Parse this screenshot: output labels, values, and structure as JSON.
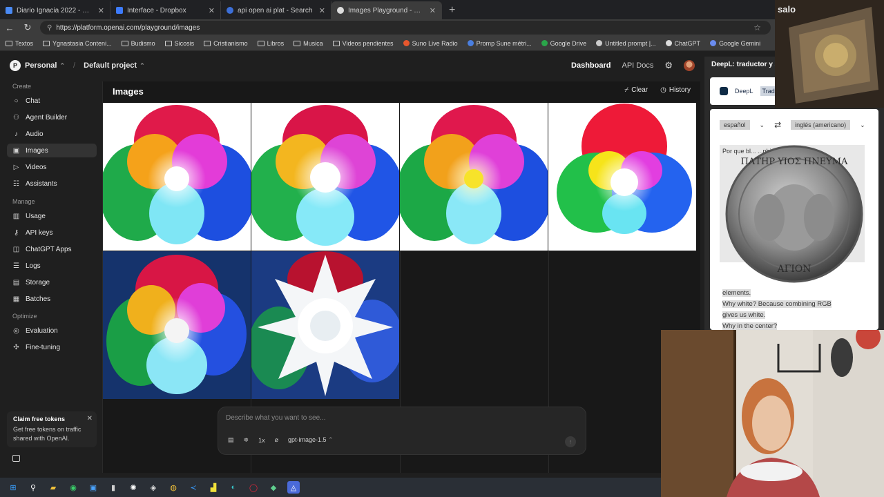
{
  "browser": {
    "tabs": [
      {
        "title": "Diario Ignacia 2022 - Documentos",
        "color": "#4a8af4"
      },
      {
        "title": "Interface - Dropbox",
        "color": "#3d7bfd"
      },
      {
        "title": "api open ai plat - Search",
        "color": "#3c6fd8"
      },
      {
        "title": "Images Playground - OpenAI API",
        "color": "#888888"
      }
    ],
    "url": "https://platform.openai.com/playground/images",
    "bookmarks": [
      {
        "label": "Textos",
        "type": "folder"
      },
      {
        "label": "Ygnastasia Conteni...",
        "type": "folder"
      },
      {
        "label": "Budismo",
        "type": "folder"
      },
      {
        "label": "Sicosis",
        "type": "folder"
      },
      {
        "label": "Cristianismo",
        "type": "folder"
      },
      {
        "label": "Libros",
        "type": "folder"
      },
      {
        "label": "Musica",
        "type": "folder"
      },
      {
        "label": "Videos pendientes",
        "type": "folder"
      },
      {
        "label": "Suno Live Radio",
        "type": "dot",
        "color": "#e8572d"
      },
      {
        "label": "Promp Sune métri...",
        "type": "dot",
        "color": "#4a7fe0"
      },
      {
        "label": "Google Drive",
        "type": "dot",
        "color": "#2aa54a"
      },
      {
        "label": "Untitled prompt |...",
        "type": "dot",
        "color": "#cccccc"
      },
      {
        "label": "ChatGPT",
        "type": "dot",
        "color": "#dcdcdc"
      },
      {
        "label": "Google Gemini",
        "type": "dot",
        "color": "#6a8cf0"
      }
    ]
  },
  "app": {
    "org_initial": "P",
    "org": "Personal",
    "project": "Default project",
    "dashboard": "Dashboard",
    "api_docs": "API Docs"
  },
  "sidebar": {
    "create_label": "Create",
    "manage_label": "Manage",
    "optimize_label": "Optimize",
    "create": [
      {
        "label": "Chat",
        "icon": "○"
      },
      {
        "label": "Agent Builder",
        "icon": "⚇"
      },
      {
        "label": "Audio",
        "icon": "♪"
      },
      {
        "label": "Images",
        "icon": "▣"
      },
      {
        "label": "Videos",
        "icon": "▷"
      },
      {
        "label": "Assistants",
        "icon": "☷"
      }
    ],
    "manage": [
      {
        "label": "Usage",
        "icon": "▥"
      },
      {
        "label": "API keys",
        "icon": "⚷"
      },
      {
        "label": "ChatGPT Apps",
        "icon": "◫"
      },
      {
        "label": "Logs",
        "icon": "☰"
      },
      {
        "label": "Storage",
        "icon": "▤"
      },
      {
        "label": "Batches",
        "icon": "▦"
      }
    ],
    "optimize": [
      {
        "label": "Evaluation",
        "icon": "◎"
      },
      {
        "label": "Fine-tuning",
        "icon": "✣"
      }
    ],
    "claim": {
      "title": "Claim free tokens",
      "desc": "Get free tokens on traffic shared with OpenAI."
    }
  },
  "main": {
    "title": "Images",
    "clear": "Clear",
    "history": "History",
    "prompt_placeholder": "Describe what you want to see...",
    "count": "1x",
    "model": "gpt-image-1.5"
  },
  "deepl": {
    "header": "DeepL: traductor y asi",
    "tab_deepl": "DeepL",
    "tab_trad": "Trad",
    "source_lang": "español",
    "target_lang": "inglés (americano)",
    "source_text": "Por que bl... ...nbinar RGB nos...",
    "coin_top": "ΠΑΤΗΡ ΥΙΟΣ ΠΝΕΥΜΑ",
    "coin_bottom": "ΑΓΙΟΝ",
    "output_lines": [
      "elements.",
      "Why white? Because combining RGB",
      "gives us white.",
      "Why in the center?"
    ]
  },
  "overlay": {
    "topcam_tag": "salo"
  },
  "colors": {
    "accent_red": "#e8182f",
    "accent_green": "#27b84a",
    "accent_blue": "#1e5ee8"
  }
}
